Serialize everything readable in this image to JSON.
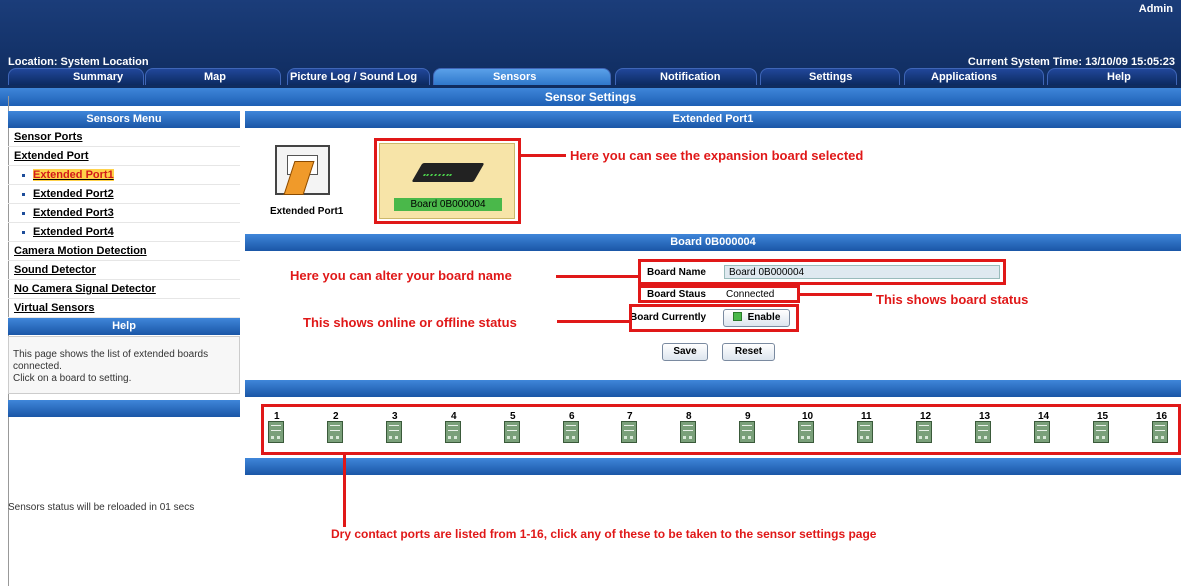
{
  "header": {
    "admin_label": "Admin",
    "location": "Location: System Location",
    "system_time": "Current System Time: 13/10/09 15:05:23"
  },
  "tabs": [
    {
      "label": "Summary"
    },
    {
      "label": "Map"
    },
    {
      "label": "Picture Log / Sound Log"
    },
    {
      "label": "Sensors",
      "active": true
    },
    {
      "label": "Notification"
    },
    {
      "label": "Settings"
    },
    {
      "label": "Applications"
    },
    {
      "label": "Help"
    }
  ],
  "page_title": "Sensor Settings",
  "sidebar": {
    "title": "Sensors Menu",
    "items": [
      {
        "label": "Sensor Ports"
      },
      {
        "label": "Extended Port"
      },
      {
        "label": "Extended Port1",
        "selected": true
      },
      {
        "label": "Extended Port2"
      },
      {
        "label": "Extended Port3"
      },
      {
        "label": "Extended Port4"
      },
      {
        "label": "Camera Motion Detection"
      },
      {
        "label": "Sound Detector"
      },
      {
        "label": "No Camera Signal Detector"
      },
      {
        "label": "Virtual Sensors"
      }
    ],
    "help_title": "Help",
    "help_line1": "This page shows the list of extended boards connected.",
    "help_line2": "Click on a board to setting.",
    "reload_text": "Sensors status will be reloaded in 01 secs"
  },
  "main": {
    "section_title": "Extended Port1",
    "port_label": "Extended Port1",
    "board_card_name": "Board 0B000004",
    "board_section_title": "Board 0B000004",
    "board_name_label": "Board Name",
    "board_name_value": "Board 0B000004",
    "board_status_label": "Board Staus",
    "board_status_value": "Connected",
    "board_currently_label": "Board Currently",
    "enable_label": "Enable",
    "save_label": "Save",
    "reset_label": "Reset",
    "ports": [
      "1",
      "2",
      "3",
      "4",
      "5",
      "6",
      "7",
      "8",
      "9",
      "10",
      "11",
      "12",
      "13",
      "14",
      "15",
      "16"
    ]
  },
  "annotations": {
    "expansion": "Here you can see the expansion board selected",
    "alter_name": "Here you can alter your board name",
    "status": "This shows board status",
    "online": "This shows online or offline status",
    "dry_contact": "Dry contact ports are listed from 1-16, click any of these to be taken to the sensor settings page"
  },
  "colors": {
    "header_bg": "#0e2a5c",
    "active_tab": "#2f78cc",
    "annotation_red": "#e01818",
    "board_card_bg": "#f7e4a8",
    "status_green": "#4ab84a"
  }
}
